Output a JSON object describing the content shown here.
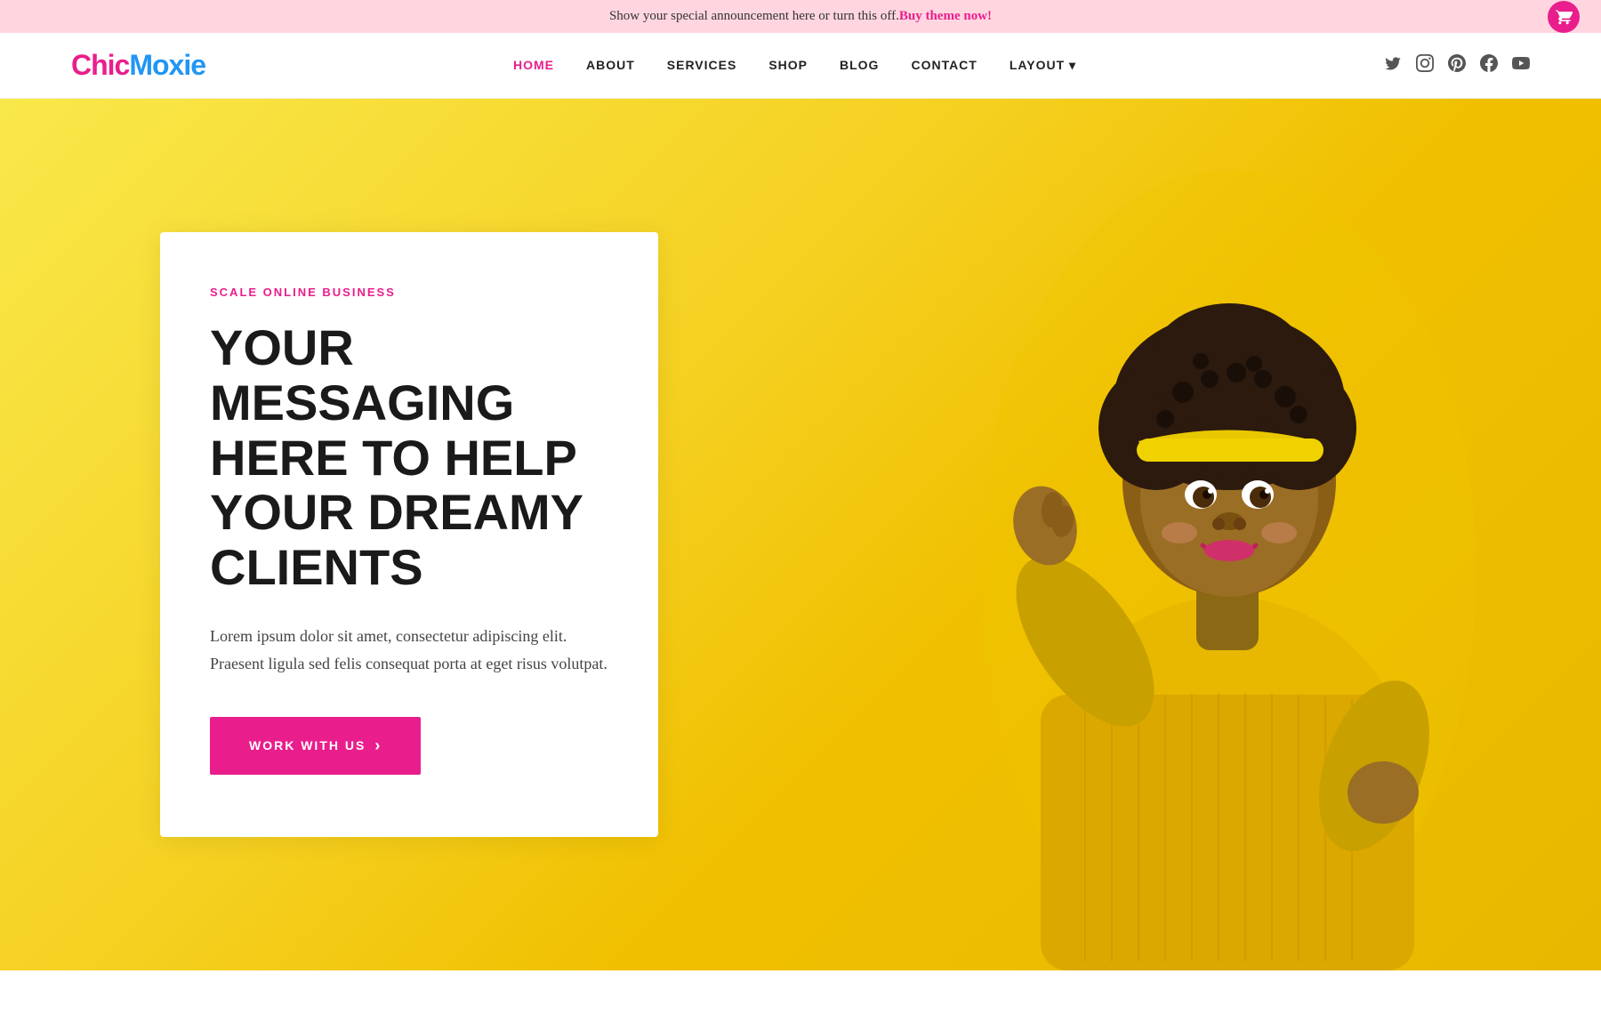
{
  "announcement": {
    "text": "Show your special announcement here or turn this off. ",
    "link_text": "Buy theme now!",
    "link_url": "#"
  },
  "cart": {
    "icon": "cart-icon"
  },
  "nav": {
    "logo_chic": "Chic",
    "logo_moxie": "Moxie",
    "links": [
      {
        "label": "HOME",
        "active": true
      },
      {
        "label": "ABOUT",
        "active": false
      },
      {
        "label": "SERVICES",
        "active": false
      },
      {
        "label": "SHOP",
        "active": false
      },
      {
        "label": "BLOG",
        "active": false
      },
      {
        "label": "CONTACT",
        "active": false
      },
      {
        "label": "LAYOUT ▾",
        "active": false
      }
    ],
    "social": [
      {
        "name": "twitter-icon",
        "symbol": "𝕏"
      },
      {
        "name": "instagram-icon",
        "symbol": "📷"
      },
      {
        "name": "pinterest-icon",
        "symbol": "P"
      },
      {
        "name": "facebook-icon",
        "symbol": "f"
      },
      {
        "name": "youtube-icon",
        "symbol": "▶"
      }
    ]
  },
  "hero": {
    "eyebrow": "SCALE ONLINE BUSINESS",
    "headline": "YOUR MESSAGING HERE TO HELP YOUR DREAMY CLIENTS",
    "body": "Lorem ipsum dolor sit amet, consectetur adipiscing elit. Praesent ligula sed felis consequat porta at eget risus volutpat.",
    "cta_label": "WORK WITH US",
    "cta_arrow": "›"
  }
}
